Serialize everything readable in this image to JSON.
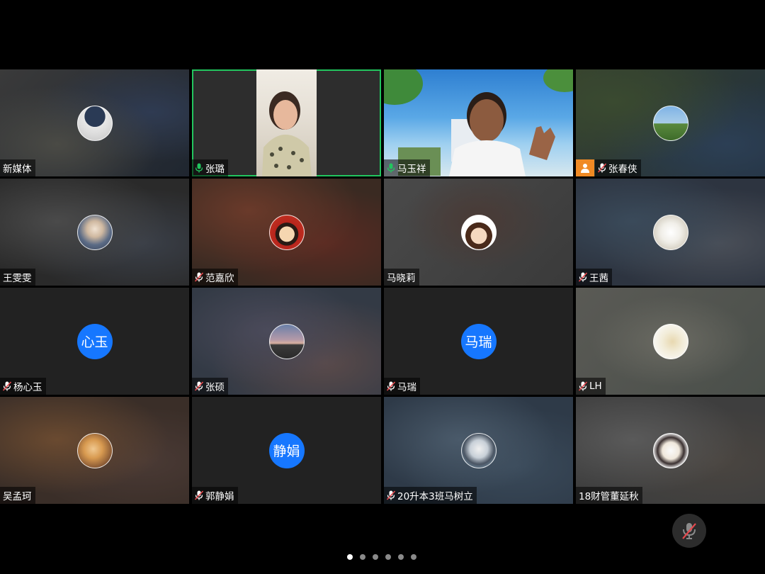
{
  "participants": [
    {
      "name": "新媒体",
      "mic": "none",
      "kind": "image-avatar"
    },
    {
      "name": "张璐",
      "mic": "on",
      "kind": "video-woman"
    },
    {
      "name": "马玉祥",
      "mic": "on",
      "kind": "video-man"
    },
    {
      "name": "张春侠",
      "mic": "off",
      "host": true,
      "kind": "image-avatar"
    },
    {
      "name": "王雯雯",
      "mic": "none",
      "kind": "image-avatar"
    },
    {
      "name": "范嘉欣",
      "mic": "off",
      "kind": "image-avatar"
    },
    {
      "name": "马晓莉",
      "mic": "none",
      "kind": "image-avatar"
    },
    {
      "name": "王茜",
      "mic": "off",
      "kind": "image-avatar"
    },
    {
      "name": "杨心玉",
      "mic": "off",
      "kind": "text-avatar",
      "avatar_text": "心玉"
    },
    {
      "name": "张硕",
      "mic": "off",
      "kind": "image-avatar"
    },
    {
      "name": "马瑞",
      "mic": "off",
      "kind": "text-avatar",
      "avatar_text": "马瑞"
    },
    {
      "name": "LH",
      "mic": "off",
      "kind": "image-avatar"
    },
    {
      "name": "吴孟珂",
      "mic": "none",
      "kind": "image-avatar"
    },
    {
      "name": "郭静娟",
      "mic": "off",
      "kind": "text-avatar",
      "avatar_text": "静娟"
    },
    {
      "name": "20升本3班马树立",
      "mic": "off",
      "kind": "image-avatar"
    },
    {
      "name": "18财管董延秋",
      "mic": "none",
      "kind": "image-avatar"
    }
  ],
  "pagination": {
    "pages": 6,
    "active": 1
  },
  "colors": {
    "speaking_border": "#22c55e",
    "text_avatar_bg": "#1677ff",
    "host_badge": "#f08a24",
    "mic_on": "#22c55e"
  },
  "icons": {
    "mic_on": "microphone-icon",
    "mic_off": "microphone-muted-icon",
    "host": "host-person-icon",
    "fab": "microphone-muted-icon"
  }
}
